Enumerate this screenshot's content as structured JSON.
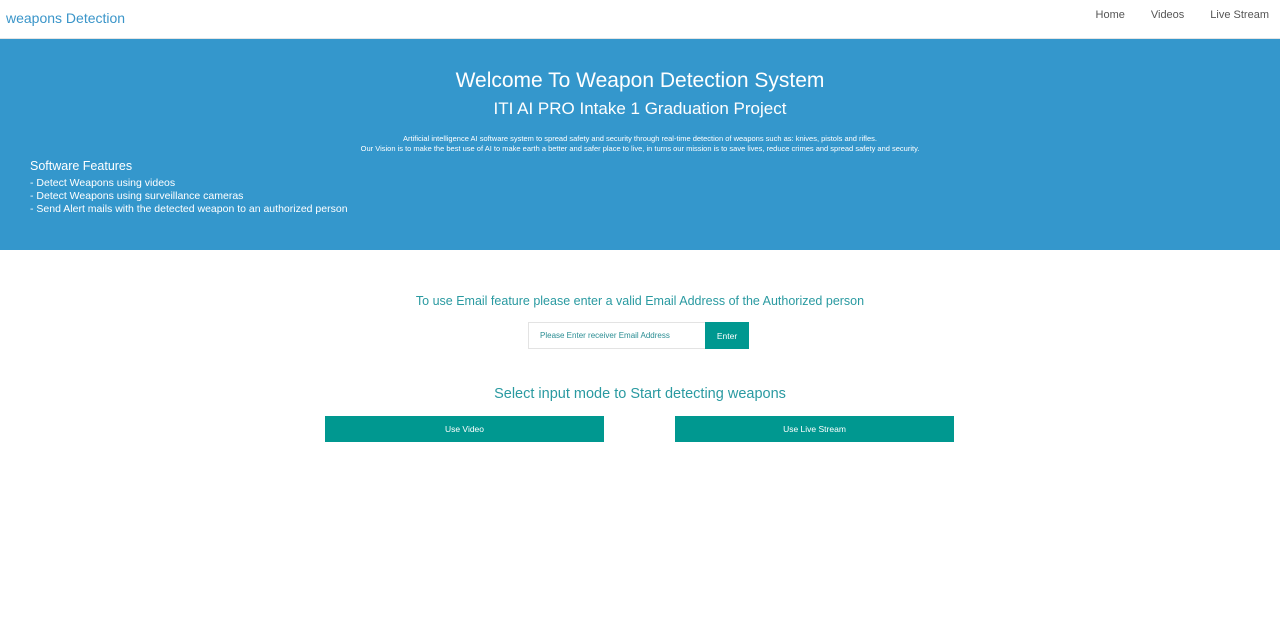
{
  "navbar": {
    "brand": "weapons Detection",
    "links": [
      "Home",
      "Videos",
      "Live Stream"
    ]
  },
  "hero": {
    "title": "Welcome To Weapon Detection System",
    "subtitle": "ITI AI PRO Intake 1 Graduation Project",
    "description_line1": "Artificial intelligence AI software system to spread safety and security through real-time detection of weapons such as: knives, pistols and rifles.",
    "description_line2": "Our Vision is to make the best use of AI to make earth a better and safer place to live, in turns our mission is to save lives, reduce crimes and spread safety and security.",
    "features_title": "Software Features",
    "features": [
      "- Detect Weapons using videos",
      "- Detect Weapons using surveillance cameras",
      "- Send Alert mails with the detected weapon to an authorized person"
    ]
  },
  "email": {
    "prompt": "To use Email feature please enter a valid Email Address of the Authorized person",
    "placeholder": "Please Enter receiver Email Address",
    "value": "",
    "button_label": "Enter"
  },
  "mode": {
    "title": "Select input mode to Start detecting weapons",
    "video_button": "Use Video",
    "live_button": "Use Live Stream"
  },
  "colors": {
    "brand": "#3a95c9",
    "hero_bg": "#3497cc",
    "teal_text": "#2a9aa1",
    "button_bg": "#009890"
  }
}
